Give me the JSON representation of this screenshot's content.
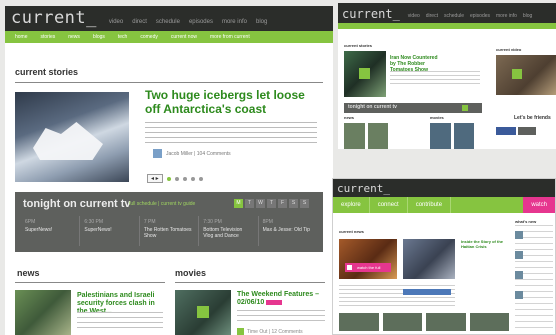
{
  "main": {
    "logo": "current_",
    "topnav": [
      "video",
      "direct",
      "schedule",
      "episodes",
      "more info",
      "blog"
    ],
    "subnav": [
      "home",
      "stories",
      "news",
      "blogs",
      "tech",
      "comedy",
      "current now",
      "more from current"
    ],
    "current_stories": {
      "heading": "current stories",
      "headline": "Two huge icebergs let loose off Antarctica's coast",
      "meta": "Jacob Miller | 104 Comments",
      "pager": "◂ ▸"
    },
    "tonight": {
      "heading": "tonight on current tv",
      "schedule_link": "full schedule | current tv guide",
      "days": [
        "M",
        "T",
        "W",
        "T",
        "F",
        "S",
        "S"
      ],
      "slots": [
        {
          "time": "6PM",
          "show": "SuperNews!"
        },
        {
          "time": "6:30 PM",
          "show": "SuperNews!"
        },
        {
          "time": "7 PM",
          "show": "The Rotten Tomatoes Show"
        },
        {
          "time": "7:30 PM",
          "show": "Bottom Television Vlog and Dance"
        },
        {
          "time": "8PM",
          "show": "Max & Jesse: Old Tip"
        }
      ]
    },
    "news": {
      "heading": "news",
      "headline": "Palestinians and Israeli security forces clash in the West..."
    },
    "movies": {
      "heading": "movies",
      "headline": "The Weekend Features – 02/06/10",
      "meta": "Time Out | 12 Comments"
    }
  },
  "thumb_top": {
    "logo": "current_",
    "topnav": [
      "video",
      "direct",
      "schedule",
      "episodes",
      "more info",
      "blog"
    ],
    "label_left": "current stories",
    "label_right": "current video",
    "video_title": "Iran Now Countered by The Robber Tomatoes Show",
    "bar_label": "tonight on current tv",
    "fans_label": "Let's be friends",
    "news_label": "news",
    "movies_label": "movies"
  },
  "thumb_bottom": {
    "logo": "current_",
    "bar_items": [
      "explore",
      "connect",
      "contribute",
      "watch"
    ],
    "label": "current news",
    "badge": "watch the full",
    "video_title": "Inside the Story of the Haitian Crisis",
    "right_label": "what's new"
  },
  "colors": {
    "accent_green": "#86c440",
    "headline_green": "#2d8a1d",
    "header_dark": "#2b2d2a",
    "panel_gray": "#5e605d",
    "pink": "#e6368f"
  }
}
